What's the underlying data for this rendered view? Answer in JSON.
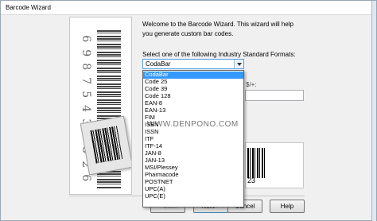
{
  "window": {
    "title": "Barcode Wizard"
  },
  "side_panel": {
    "digits": [
      "6",
      "9",
      "8",
      "7",
      "5",
      "4",
      "3",
      "6",
      "5",
      "2",
      "6"
    ]
  },
  "main": {
    "intro_text": "Welcome to the Barcode Wizard.  This wizard will help you generate custom bar codes.",
    "select_label": "Select one of the following Industry Standard Formats:",
    "selected_format": "CodaBar",
    "separator_hint": "$/+:",
    "preview_digits": "23"
  },
  "dropdown": {
    "options": [
      "CodaBar",
      "Code 25",
      "Code 39",
      "Code 128",
      "EAN-8",
      "EAN-13",
      "FIM",
      "ISBN",
      "ISSN",
      "ITF",
      "ITF-14",
      "JAN-8",
      "JAN-13",
      "MSI/Plessey",
      "Pharmacode",
      "POSTNET",
      "UPC(A)",
      "UPC(E)"
    ],
    "selected_index": 0
  },
  "buttons": {
    "back": "< Back",
    "next": "Next >",
    "cancel": "Cancel",
    "help": "Help"
  },
  "watermark": "WWW.DENPONO.COM",
  "colors": {
    "selection": "#3399ff",
    "focus_border": "#569de5"
  }
}
